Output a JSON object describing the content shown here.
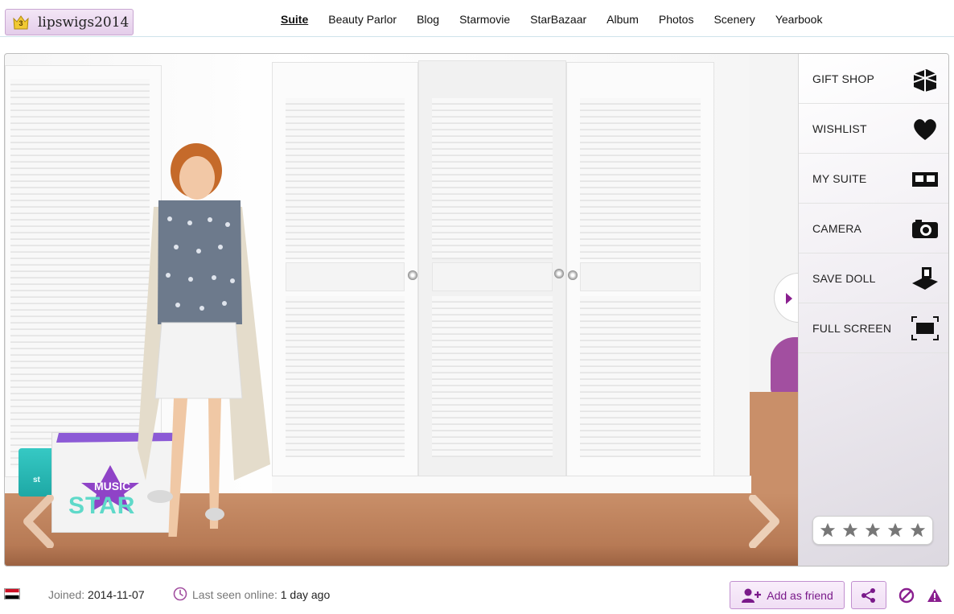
{
  "header": {
    "username": "lipswigs2014",
    "level": "3",
    "nav": [
      {
        "label": "Suite",
        "active": true
      },
      {
        "label": "Beauty Parlor"
      },
      {
        "label": "Blog"
      },
      {
        "label": "Starmovie"
      },
      {
        "label": "StarBazaar"
      },
      {
        "label": "Album"
      },
      {
        "label": "Photos"
      },
      {
        "label": "Scenery"
      },
      {
        "label": "Yearbook"
      }
    ]
  },
  "scene": {
    "bag_text_1": "MUSIC",
    "bag_text_2": "STAR",
    "box_text": "st"
  },
  "side_menu": [
    {
      "label": "GIFT SHOP",
      "icon": "gift-icon"
    },
    {
      "label": "WISHLIST",
      "icon": "heart-icon"
    },
    {
      "label": "MY SUITE",
      "icon": "suite-icon"
    },
    {
      "label": "CAMERA",
      "icon": "camera-icon"
    },
    {
      "label": "SAVE DOLL",
      "icon": "save-doll-icon"
    },
    {
      "label": "FULL SCREEN",
      "icon": "fullscreen-icon"
    }
  ],
  "rating": {
    "stars": 5,
    "filled": 0
  },
  "footer": {
    "joined_label": "Joined:",
    "joined_date": "2014-11-07",
    "seen_label": "Last seen online:",
    "seen_value": "1 day ago",
    "add_friend_label": "Add as friend"
  },
  "colors": {
    "accent_purple": "#7a1a8a",
    "button_bg": "#f0def4",
    "floor": "#c98f69"
  }
}
